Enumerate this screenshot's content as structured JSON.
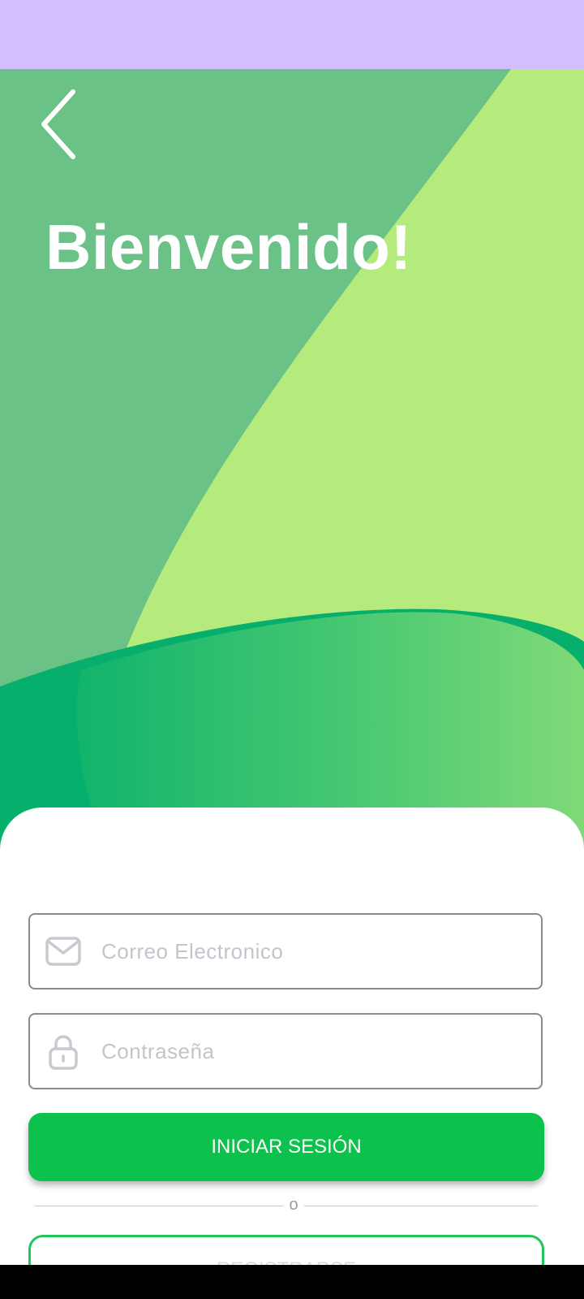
{
  "status_bar": {
    "color": "#d2bfff"
  },
  "header": {
    "back_icon": "chevron-left-icon",
    "title": "Bienvenido!"
  },
  "hero": {
    "colors": {
      "base": "#6bc286",
      "highlight": "#b5ea7d",
      "wave_dark": "#06b06c",
      "wave_light": "#86dc79"
    }
  },
  "login_form": {
    "email": {
      "icon": "mail-icon",
      "placeholder": "Correo Electronico",
      "value": ""
    },
    "password": {
      "icon": "lock-icon",
      "placeholder": "Contraseña",
      "value": ""
    },
    "login_button_label": "INICIAR SESIÓN",
    "separator_text": "o",
    "register_button_label": "REGISTRARSE"
  },
  "colors": {
    "primary_green": "#0cc24c",
    "outline_green": "#20c659",
    "placeholder_gray": "#c4c4cc"
  }
}
